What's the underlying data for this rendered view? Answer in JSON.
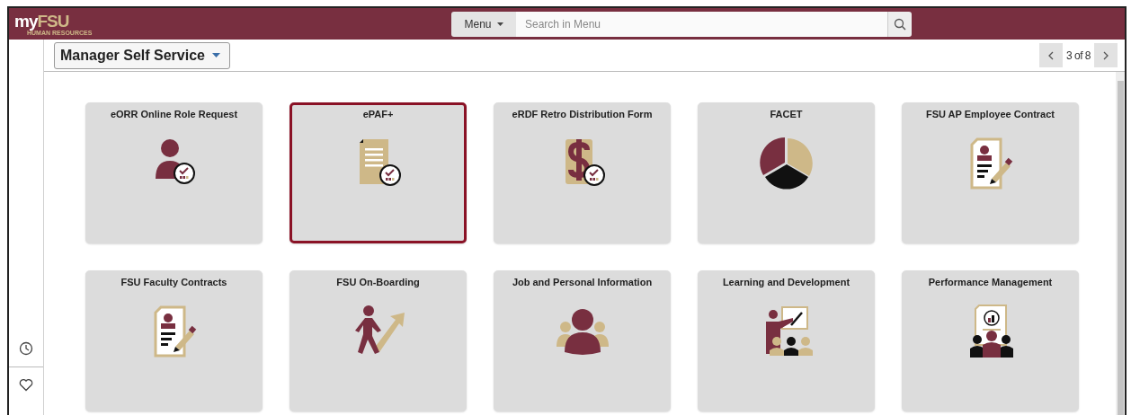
{
  "header": {
    "logo": {
      "my": "my",
      "fsu": "FSU",
      "tagline": "HUMAN RESOURCES"
    },
    "menu_button": "Menu",
    "search": {
      "placeholder": "Search in Menu"
    }
  },
  "sidebar": {
    "items": [
      {
        "kind": "recent"
      },
      {
        "kind": "favorites"
      }
    ]
  },
  "homepage_selector": {
    "label": "Manager Self Service"
  },
  "pager": {
    "text": "3 of 8"
  },
  "tiles": [
    {
      "title": "eORR Online Role Request",
      "kind": "role-request",
      "selected": false
    },
    {
      "title": "ePAF+",
      "kind": "document-check",
      "selected": true
    },
    {
      "title": "eRDF Retro Distribution Form",
      "kind": "dollar-check",
      "selected": false
    },
    {
      "title": "FACET",
      "kind": "pie",
      "selected": false
    },
    {
      "title": "FSU AP Employee Contract",
      "kind": "contract",
      "selected": false
    },
    {
      "title": "FSU Faculty Contracts",
      "kind": "faculty-contract",
      "selected": false
    },
    {
      "title": "FSU On-Boarding",
      "kind": "walker",
      "selected": false
    },
    {
      "title": "Job and Personal Information",
      "kind": "people",
      "selected": false
    },
    {
      "title": "Learning and Development",
      "kind": "teacher",
      "selected": false
    },
    {
      "title": "Performance Management",
      "kind": "performance",
      "selected": false
    }
  ]
}
